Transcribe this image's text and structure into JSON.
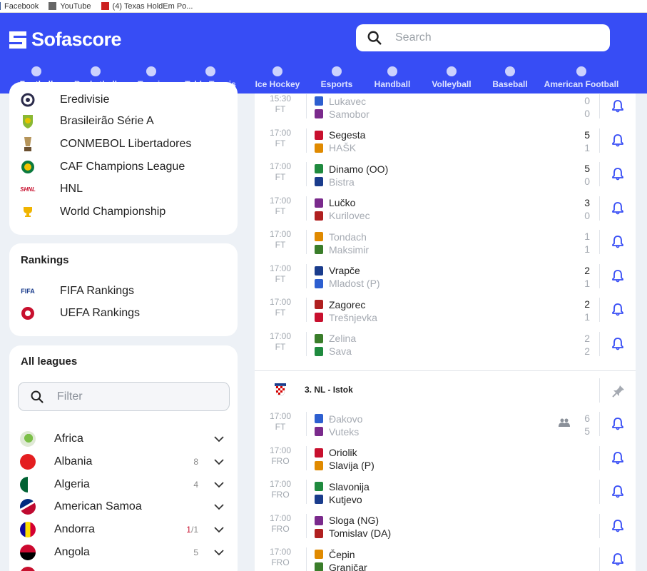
{
  "bookmarks": [
    {
      "label": "Facebook",
      "color": "#3b5998"
    },
    {
      "label": "YouTube",
      "color": "#555555"
    },
    {
      "label": "(4) Texas HoldEm Po...",
      "color": "#cc2222"
    }
  ],
  "header": {
    "brand": "Sofascore",
    "search_placeholder": "Search",
    "accent": "#374df5"
  },
  "sports": [
    {
      "label": "Football",
      "active": true
    },
    {
      "label": "Basketball"
    },
    {
      "label": "Tennis"
    },
    {
      "label": "Table Tennis"
    },
    {
      "label": "Ice Hockey"
    },
    {
      "label": "Esports"
    },
    {
      "label": "Handball"
    },
    {
      "label": "Volleyball"
    },
    {
      "label": "Baseball"
    },
    {
      "label": "American Football"
    }
  ],
  "top_leagues": [
    {
      "name": "Eredivisie",
      "icon": "eredivisie-icon"
    },
    {
      "name": "Brasileirão Série A",
      "icon": "brasileirao-icon"
    },
    {
      "name": "CONMEBOL Libertadores",
      "icon": "libertadores-icon"
    },
    {
      "name": "CAF Champions League",
      "icon": "caf-icon"
    },
    {
      "name": "HNL",
      "icon": "hnl-icon",
      "badge": "SHNL"
    },
    {
      "name": "World Championship",
      "icon": "trophy-icon"
    }
  ],
  "rankings": {
    "title": "Rankings",
    "items": [
      {
        "name": "FIFA Rankings",
        "badge": "FIFA"
      },
      {
        "name": "UEFA Rankings"
      }
    ]
  },
  "all_leagues": {
    "title": "All leagues",
    "filter_placeholder": "Filter",
    "countries": [
      {
        "name": "Africa",
        "count": ""
      },
      {
        "name": "Albania",
        "count": "8"
      },
      {
        "name": "Algeria",
        "count": "4"
      },
      {
        "name": "American Samoa",
        "count": ""
      },
      {
        "name": "Andorra",
        "count_live": "1",
        "count_total": "/1"
      },
      {
        "name": "Angola",
        "count": "5"
      }
    ]
  },
  "matches": [
    {
      "time": "15:30",
      "status": "FT",
      "home": "Lukavec",
      "away": "Samobor",
      "hs": "0",
      "as": "0",
      "home_win": false,
      "away_win": false
    },
    {
      "time": "17:00",
      "status": "FT",
      "home": "Segesta",
      "away": "HAŠK",
      "hs": "5",
      "as": "1",
      "home_win": true,
      "away_win": false
    },
    {
      "time": "17:00",
      "status": "FT",
      "home": "Dinamo (OO)",
      "away": "Bistra",
      "hs": "5",
      "as": "0",
      "home_win": true,
      "away_win": false
    },
    {
      "time": "17:00",
      "status": "FT",
      "home": "Lučko",
      "away": "Kurilovec",
      "hs": "3",
      "as": "0",
      "home_win": true,
      "away_win": false
    },
    {
      "time": "17:00",
      "status": "FT",
      "home": "Tondach",
      "away": "Maksimir",
      "hs": "1",
      "as": "1",
      "home_win": false,
      "away_win": false
    },
    {
      "time": "17:00",
      "status": "FT",
      "home": "Vrapče",
      "away": "Mladost (P)",
      "hs": "2",
      "as": "1",
      "home_win": true,
      "away_win": false
    },
    {
      "time": "17:00",
      "status": "FT",
      "home": "Zagorec",
      "away": "Trešnjevka",
      "hs": "2",
      "as": "1",
      "home_win": true,
      "away_win": false
    },
    {
      "time": "17:00",
      "status": "FT",
      "home": "Zelina",
      "away": "Sava",
      "hs": "2",
      "as": "2",
      "home_win": false,
      "away_win": false
    }
  ],
  "league_section": {
    "name": "3. NL - Istok",
    "matches": [
      {
        "time": "17:00",
        "status": "FT",
        "home": "Đakovo",
        "away": "Vuteks",
        "hs": "6",
        "as": "5",
        "home_win": false,
        "away_win": false,
        "lineups": true
      },
      {
        "time": "17:00",
        "status": "FRO",
        "home": "Oriolik",
        "away": "Slavija (P)",
        "hs": "",
        "as": "",
        "home_win": true,
        "away_win": true
      },
      {
        "time": "17:00",
        "status": "FRO",
        "home": "Slavonija",
        "away": "Kutjevo",
        "hs": "",
        "as": "",
        "home_win": true,
        "away_win": true
      },
      {
        "time": "17:00",
        "status": "FRO",
        "home": "Sloga (NG)",
        "away": "Tomislav (DA)",
        "hs": "",
        "as": "",
        "home_win": true,
        "away_win": true
      },
      {
        "time": "17:00",
        "status": "FRO",
        "home": "Čepin",
        "away": "Graničar",
        "hs": "",
        "as": "",
        "home_win": true,
        "away_win": true
      }
    ]
  }
}
